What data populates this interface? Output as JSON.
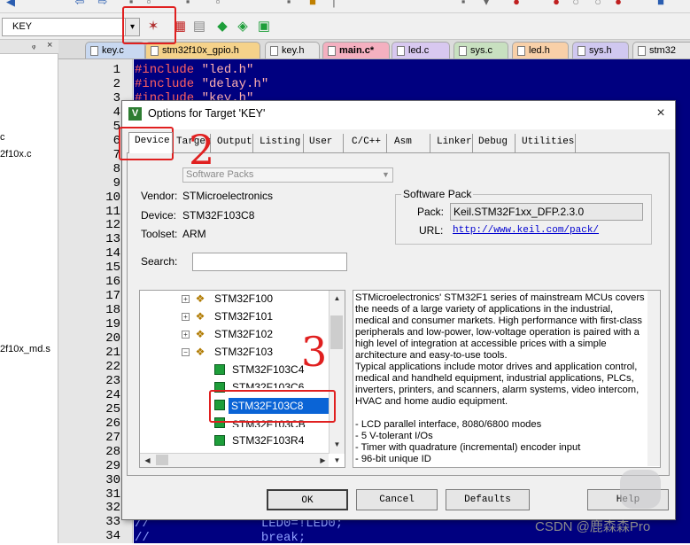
{
  "toolbar": {
    "target_name": "KEY",
    "icons": [
      "undo-icon",
      "redo-icon",
      "options-for-target-icon",
      "manage-project-items-icon",
      "select-packs-icon",
      "manage-run-time-icon",
      "run-time-icon"
    ]
  },
  "project_panel": {
    "pin": "ᵩ",
    "close": "×",
    "visible_text": [
      "c",
      "2f10x.c",
      "2f10x_md.s"
    ]
  },
  "editor_tabs": [
    {
      "label": "key.c",
      "color": "#c8d8f0"
    },
    {
      "label": "stm32f10x_gpio.h",
      "color": "#f5d28a"
    },
    {
      "label": "key.h",
      "color": "#e8e8e8"
    },
    {
      "label": "main.c*",
      "color": "#f4b0c0"
    },
    {
      "label": "led.c",
      "color": "#d8c8f0"
    },
    {
      "label": "sys.c",
      "color": "#c8e0c0"
    },
    {
      "label": "led.h",
      "color": "#f8d0a8"
    },
    {
      "label": "sys.h",
      "color": "#d0c8f0"
    },
    {
      "label": "stm32",
      "color": "#e8e8e8"
    }
  ],
  "code": {
    "line_numbers": [
      "1",
      "2",
      "3",
      "4",
      "5",
      "6",
      "7",
      "8",
      "9",
      "10",
      "11",
      "12",
      "13",
      "14",
      "15",
      "16",
      "17",
      "18",
      "19",
      "20",
      "21",
      "22",
      "23",
      "24",
      "25",
      "26",
      "27",
      "28",
      "29",
      "30",
      "31",
      "32",
      "33",
      "34"
    ],
    "visible_lines": [
      {
        "line": 1,
        "kw": "#include",
        "str": "\"led.h\""
      },
      {
        "line": 2,
        "kw": "#include",
        "str": "\"delay.h\""
      },
      {
        "line": 3,
        "kw": "#include",
        "str": "\"key.h\""
      }
    ],
    "line_33": "//               LED0=!LED0;",
    "line_34": "//               break;"
  },
  "dialog": {
    "title": "Options for Target 'KEY'",
    "close": "×",
    "tabs": [
      "Device",
      "Target",
      "Output",
      "Listing",
      "User",
      "C/C++",
      "Asm",
      "Linker",
      "Debug",
      "Utilities"
    ],
    "active_tab": "Device",
    "software_packs_combo": "Software Packs",
    "vendor_label": "Vendor:",
    "vendor_value": "STMicroelectronics",
    "device_label": "Device:",
    "device_value": "STM32F103C8",
    "toolset_label": "Toolset:",
    "toolset_value": "ARM",
    "search_label": "Search:",
    "search_value": "",
    "software_pack_group": "Software Pack",
    "pack_label": "Pack:",
    "pack_value": "Keil.STM32F1xx_DFP.2.3.0",
    "url_label": "URL:",
    "url_value": "http://www.keil.com/pack/",
    "tree": {
      "families": [
        "STM32F100",
        "STM32F101",
        "STM32F102",
        "STM32F103"
      ],
      "devices": [
        "STM32F103C4",
        "STM32F103C6",
        "STM32F103C8",
        "STM32F103CB",
        "STM32F103R4"
      ],
      "selected": "STM32F103C8"
    },
    "description": [
      "STMicroelectronics' STM32F1 series of mainstream MCUs covers the needs of a large variety of applications in the industrial, medical and consumer markets. High performance with first-class peripherals and low-power, low-voltage operation is paired with a high level of integration at accessible prices with a simple architecture and easy-to-use tools.",
      "Typical applications include motor drives and application control, medical and handheld equipment, industrial applications, PLCs, inverters, printers, and scanners, alarm systems, video intercom, HVAC and home audio equipment.",
      "- LCD parallel interface, 8080/6800 modes",
      "- 5 V-tolerant I/Os",
      "- Timer with quadrature (incremental) encoder input",
      "- 96-bit unique ID"
    ],
    "buttons": {
      "ok": "OK",
      "cancel": "Cancel",
      "defaults": "Defaults",
      "help": "Help"
    }
  },
  "annotations": {
    "step2": "2",
    "step3": "3"
  },
  "watermark": "CSDN @鹿森森Pro",
  "colors": {
    "editor_bg": "#000080",
    "annotation_red": "#e02020",
    "selection": "#0a64d6"
  }
}
